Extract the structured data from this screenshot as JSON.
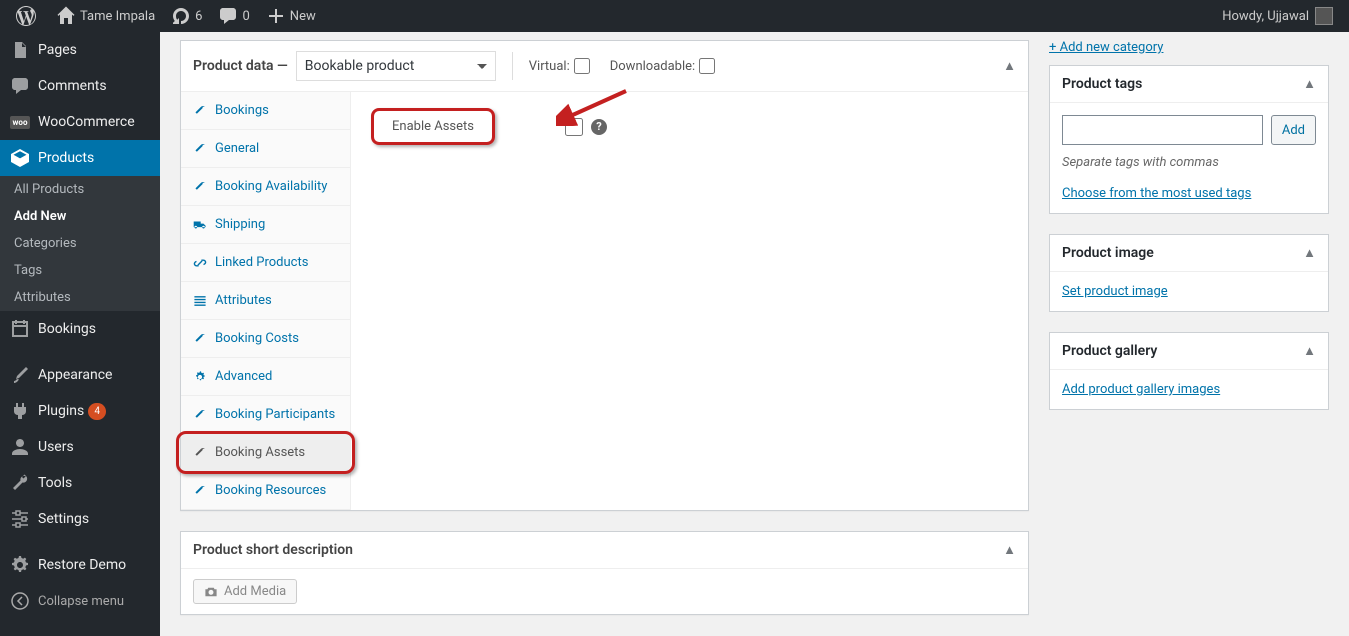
{
  "adminbar": {
    "site": "Tame Impala",
    "updates": "6",
    "comments": "0",
    "new": "New",
    "howdy": "Howdy, Ujjawal"
  },
  "menu": {
    "pages": "Pages",
    "comments": "Comments",
    "woocommerce": "WooCommerce",
    "products": "Products",
    "bookings": "Bookings",
    "appearance": "Appearance",
    "plugins": "Plugins",
    "plugins_count": "4",
    "users": "Users",
    "tools": "Tools",
    "settings": "Settings",
    "restore": "Restore Demo",
    "collapse": "Collapse menu",
    "sub": {
      "all": "All Products",
      "addnew": "Add New",
      "categories": "Categories",
      "tags": "Tags",
      "attributes": "Attributes"
    }
  },
  "product_data": {
    "header_label": "Product data —",
    "type_selected": "Bookable product",
    "virtual_label": "Virtual:",
    "downloadable_label": "Downloadable:",
    "tabs": {
      "bookings": "Bookings",
      "general": "General",
      "availability": "Booking Availability",
      "shipping": "Shipping",
      "linked": "Linked Products",
      "attributes": "Attributes",
      "costs": "Booking Costs",
      "advanced": "Advanced",
      "participants": "Booking Participants",
      "assets": "Booking Assets",
      "resources": "Booking Resources"
    },
    "panel": {
      "enable_assets": "Enable Assets"
    }
  },
  "add_new_cat": "+ Add new category",
  "tags_box": {
    "title": "Product tags",
    "add": "Add",
    "hint": "Separate tags with commas",
    "choose": "Choose from the most used tags"
  },
  "image_box": {
    "title": "Product image",
    "set": "Set product image"
  },
  "gallery_box": {
    "title": "Product gallery",
    "add": "Add product gallery images"
  },
  "short_desc": {
    "title": "Product short description",
    "add_media": "Add Media"
  }
}
